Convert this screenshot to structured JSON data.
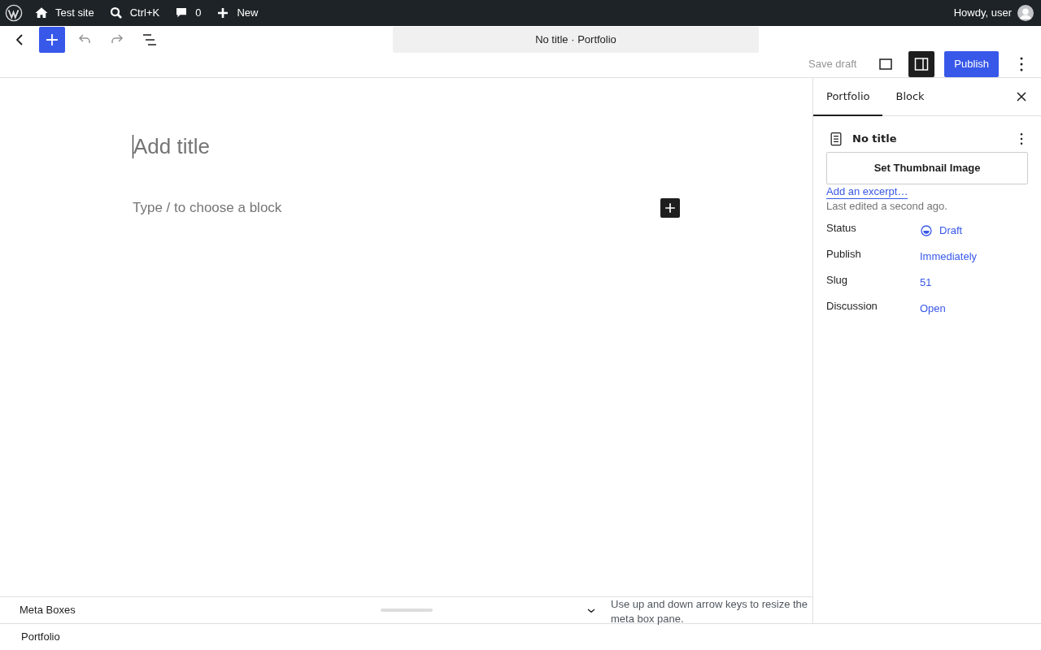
{
  "admin_bar": {
    "items": [
      {
        "kind": "site",
        "label": "Test site"
      },
      {
        "kind": "search",
        "label": "Ctrl+K"
      },
      {
        "kind": "comments",
        "label": "0"
      },
      {
        "kind": "new",
        "label": "New"
      }
    ],
    "greeting": "Howdy, user"
  },
  "header": {
    "document_title": "No title · Portfolio",
    "save_draft": "Save draft",
    "publish": "Publish",
    "undo_disabled": true,
    "redo_disabled": true,
    "settings_on": true
  },
  "editor": {
    "title_placeholder": "Add title",
    "block_placeholder": "Type / to choose a block"
  },
  "sidebar": {
    "tabs": [
      {
        "label": "Portfolio",
        "selected": true
      },
      {
        "label": "Block",
        "selected": false
      }
    ],
    "post_title": "No title",
    "thumbnail_button": "Set Thumbnail Image",
    "excerpt_link": "Add an excerpt…",
    "last_edited": "Last edited a second ago.",
    "fields": [
      {
        "kind": "status",
        "label": "Status",
        "value": "Draft"
      },
      {
        "kind": "plain",
        "label": "Publish",
        "value": "Immediately"
      },
      {
        "kind": "plain",
        "label": "Slug",
        "value": "51"
      },
      {
        "kind": "plain",
        "label": "Discussion",
        "value": "Open"
      }
    ]
  },
  "meta_boxes": {
    "title": "Meta Boxes",
    "hint": "Use up and down arrow keys to resize the meta box pane.",
    "expanded": true
  },
  "footer": {
    "breadcrumb": "Portfolio"
  }
}
